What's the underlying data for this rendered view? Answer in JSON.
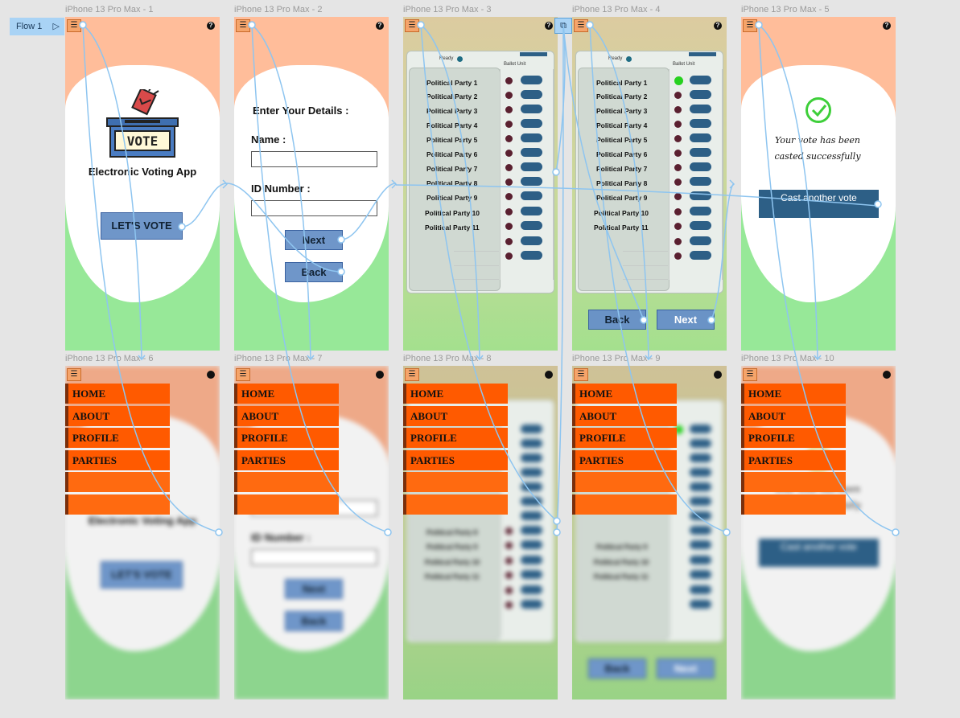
{
  "flow_tag": {
    "label": "Flow 1",
    "play_icon": "play-icon"
  },
  "frames": [
    {
      "label": "iPhone 13 Pro Max - 1"
    },
    {
      "label": "iPhone 13 Pro Max - 2"
    },
    {
      "label": "iPhone 13 Pro Max - 3"
    },
    {
      "label": "iPhone 13 Pro Max - 4"
    },
    {
      "label": "iPhone 13 Pro Max - 5"
    },
    {
      "label": "iPhone 13 Pro Max - 6"
    },
    {
      "label": "iPhone 13 Pro Max - 7"
    },
    {
      "label": "iPhone 13 Pro Max - 8"
    },
    {
      "label": "iPhone 13 Pro Max - 9"
    },
    {
      "label": "iPhone 13 Pro Max - 10"
    }
  ],
  "home": {
    "vote_label": "VOTE",
    "app_title": "Electronic Voting App",
    "cta": "LET'S VOTE"
  },
  "details": {
    "heading": "Enter Your Details :",
    "name_label": "Name :",
    "id_label": "ID Number :",
    "next": "Next",
    "back": "Back"
  },
  "evm": {
    "ready": "Ready",
    "ballot": "Ballot Unit",
    "parties": [
      "Political Party 1",
      "Political Party 2",
      "Political Party 3",
      "Political Party 4",
      "Political Party 5",
      "Political Party 6",
      "Political Party 7",
      "Political Party 8",
      "Political Party 9",
      "Political Party 10",
      "Political Party 11"
    ],
    "back": "Back",
    "next": "Next"
  },
  "success": {
    "message": "Your vote has been casted successfully",
    "cta": "Cast another vote"
  },
  "nav": {
    "items": [
      "HOME",
      "ABOUT",
      "PROFILE",
      "PARTIES"
    ]
  },
  "colors": {
    "peach": "#ffbd9a",
    "green": "#97e898",
    "nav_orange": "#ff5a00",
    "button_blue": "#6f96c9",
    "button_dark": "#2d5f86",
    "connector": "#8ec5f0"
  }
}
